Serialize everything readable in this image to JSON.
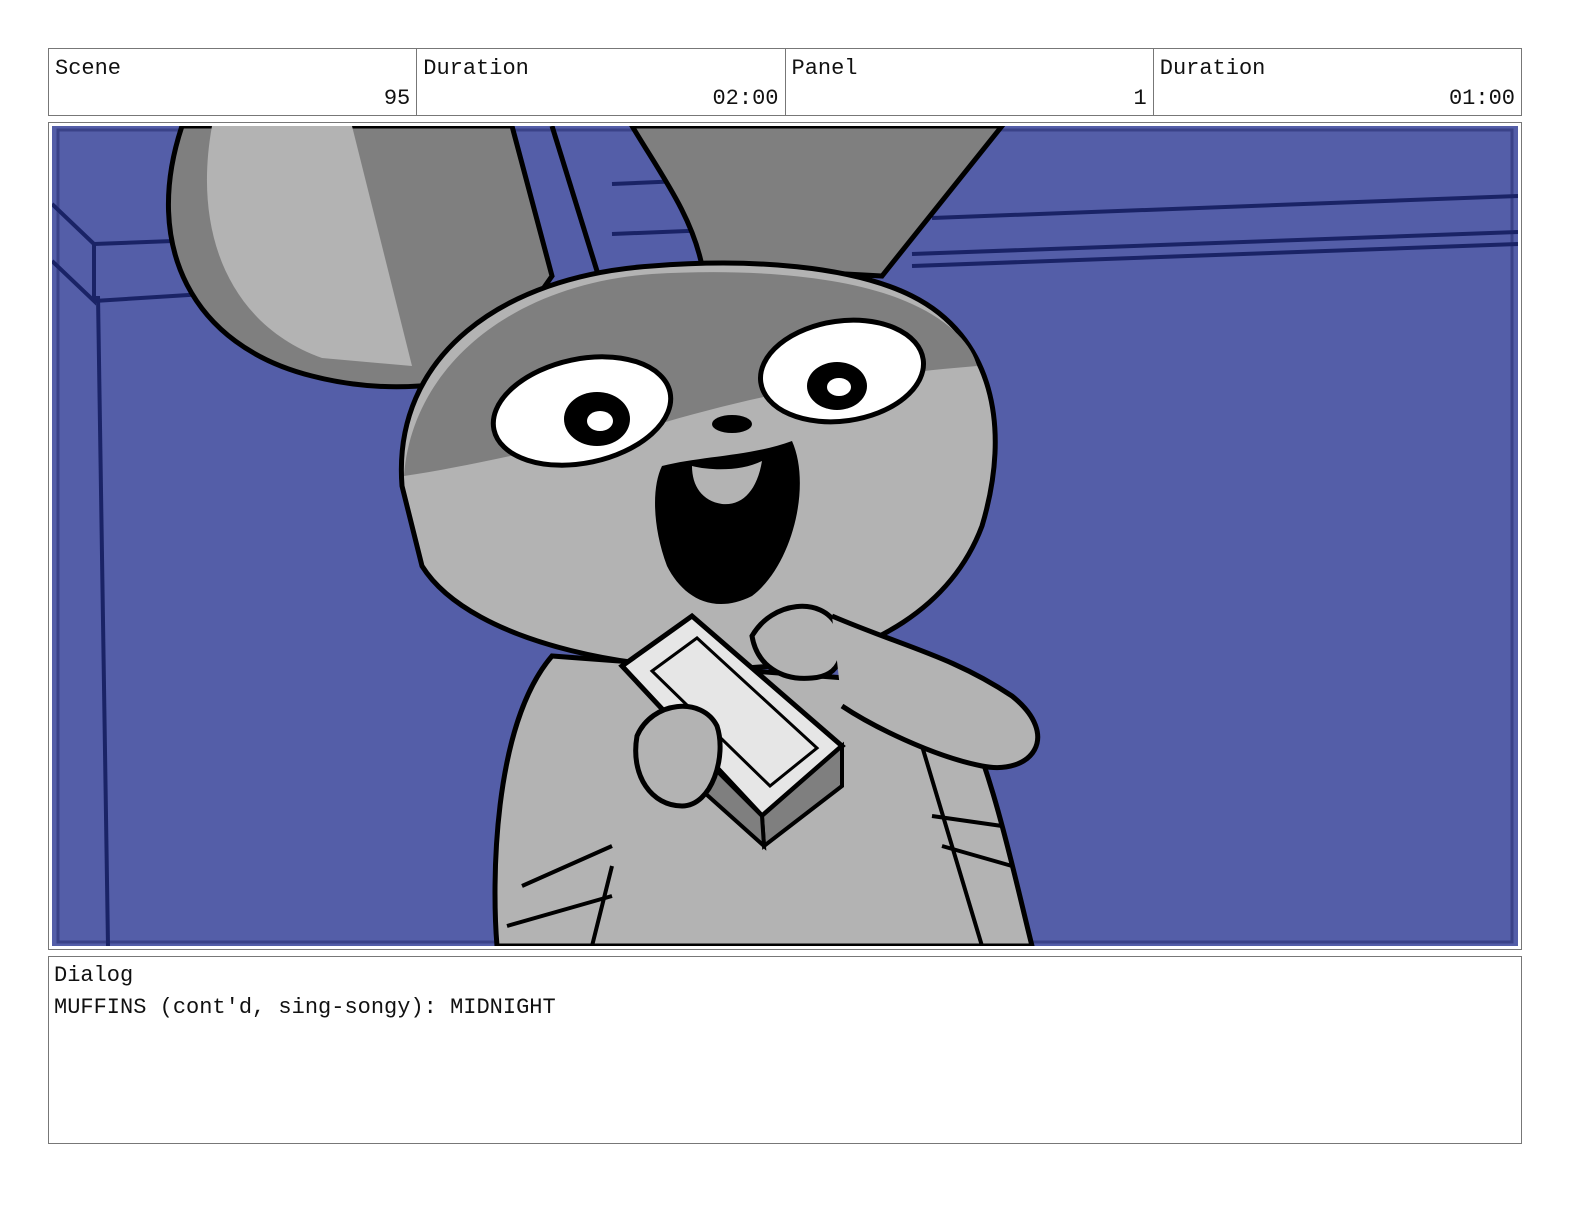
{
  "header": {
    "scene_label": "Scene",
    "scene_value": "95",
    "scene_duration_label": "Duration",
    "scene_duration_value": "02:00",
    "panel_label": "Panel",
    "panel_value": "1",
    "panel_duration_label": "Duration",
    "panel_duration_value": "01:00"
  },
  "dialog": {
    "label": "Dialog",
    "text": "MUFFINS (cont'd, sing-songy): MIDNIGHT"
  },
  "colors": {
    "background_wall": "#545ea8",
    "wall_lines": "#1a2366",
    "character_gray": "#b3b3b3",
    "character_dark": "#7f7f7f"
  }
}
